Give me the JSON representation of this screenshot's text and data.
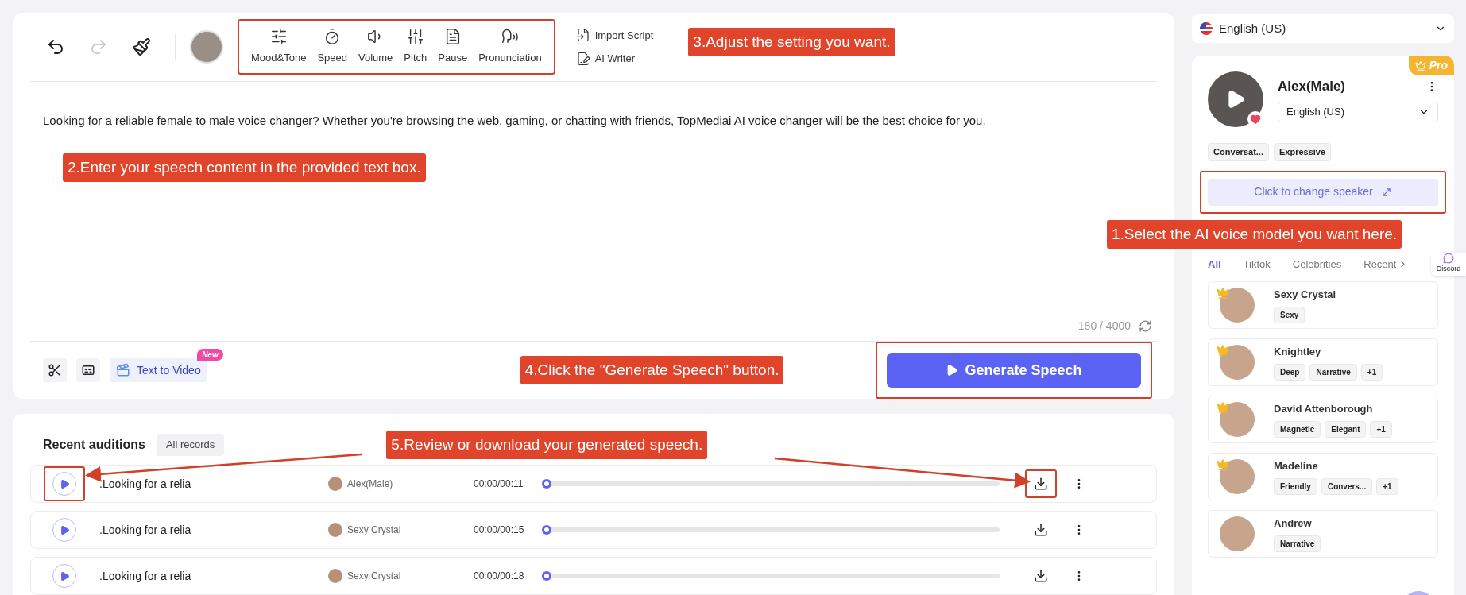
{
  "editor": {
    "history": [
      {
        "disabled": false
      },
      {
        "disabled": true
      }
    ],
    "tools": {
      "highlighted": true,
      "items": [
        {
          "label": "Mood&Tone"
        },
        {
          "label": "Speed"
        },
        {
          "label": "Volume"
        },
        {
          "label": "Pitch"
        },
        {
          "label": "Pause"
        },
        {
          "label": "Pronunciation"
        }
      ]
    },
    "side_actions": [
      {
        "label": "Import Script"
      },
      {
        "label": "AI Writer"
      }
    ],
    "text": "Looking for a reliable female to male voice changer? Whether you're browsing the web, gaming, or chatting with friends, TopMediai AI voice changer will be the best choice for you.",
    "char_count": "180 / 4000",
    "footer": {
      "text_to_video": "Text to Video",
      "new_badge": "New",
      "generate_button": {
        "label": "Generate Speech",
        "highlighted": true
      }
    }
  },
  "recent": {
    "title": "Recent auditions",
    "all_records": "All records",
    "rows": [
      {
        "title": ".Looking for a relia",
        "speaker": "Alex(Male)",
        "time": "00:00/00:11",
        "level": 0,
        "highlighted": true
      },
      {
        "title": ".Looking for a relia",
        "speaker": "Sexy Crystal",
        "time": "00:00/00:15",
        "level": 0,
        "highlighted": false
      },
      {
        "title": ".Looking for a relia",
        "speaker": "Sexy Crystal",
        "time": "00:00/00:18",
        "level": 0,
        "highlighted": false
      }
    ]
  },
  "language_select": {
    "value": "English (US)"
  },
  "speaker_card": {
    "badge": "Pro",
    "name": "Alex(Male)",
    "language": "English (US)",
    "favorite": true,
    "tags": [
      "Conversat...",
      "Expressive"
    ],
    "change_button": {
      "label": "Click to change speaker",
      "highlighted": true
    }
  },
  "voice_tabs": [
    {
      "label": "All",
      "selected": true
    },
    {
      "label": "Tiktok",
      "selected": false
    },
    {
      "label": "Celebrities",
      "selected": false
    },
    {
      "label": "Recent",
      "selected": false
    }
  ],
  "voices": [
    {
      "name": "Sexy Crystal",
      "tags": [
        "Sexy"
      ],
      "premium": true
    },
    {
      "name": "Knightley",
      "tags": [
        "Deep",
        "Narrative",
        "+1"
      ],
      "premium": true
    },
    {
      "name": "David Attenborough",
      "tags": [
        "Magnetic",
        "Elegant",
        "+1"
      ],
      "premium": true
    },
    {
      "name": "Madeline",
      "tags": [
        "Friendly",
        "Convers...",
        "+1"
      ],
      "premium": true
    },
    {
      "name": "Andrew",
      "tags": [
        "Narrative"
      ],
      "premium": false
    }
  ],
  "discord": {
    "label": "Discord"
  },
  "annotations": [
    {
      "kind": "callout",
      "text": "1.Select the AI voice model you want here."
    },
    {
      "kind": "callout",
      "text": "2.Enter your speech content in the provided text box."
    },
    {
      "kind": "callout",
      "text": "3.Adjust the setting you want."
    },
    {
      "kind": "callout",
      "text": "4.Click the \"Generate Speech\" button."
    },
    {
      "kind": "callout",
      "text": "5.Review or download your generated speech."
    }
  ]
}
